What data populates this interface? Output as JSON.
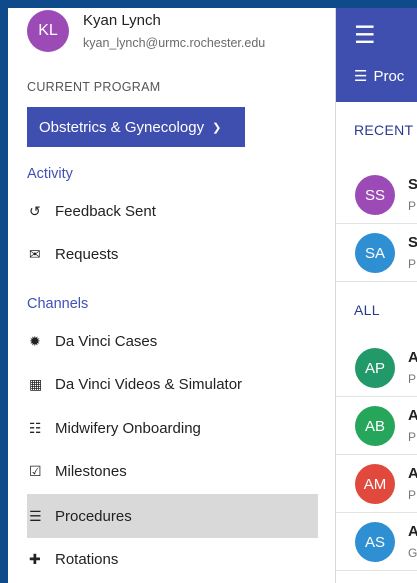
{
  "user": {
    "initials": "KL",
    "name": "Kyan Lynch",
    "email": "kyan_lynch@urmc.rochester.edu",
    "avatar_color": "#9c4bb6"
  },
  "program": {
    "caption": "CURRENT PROGRAM",
    "selected": "Obstetrics & Gynecology"
  },
  "activity": {
    "title": "Activity",
    "items": [
      {
        "label": "Feedback Sent",
        "icon": "history-icon"
      },
      {
        "label": "Requests",
        "icon": "envelope-icon"
      }
    ]
  },
  "channels": {
    "title": "Channels",
    "items": [
      {
        "label": "Da Vinci Cases",
        "icon": "certificate-icon"
      },
      {
        "label": "Da Vinci Videos & Simulator",
        "icon": "film-icon"
      },
      {
        "label": "Midwifery Onboarding",
        "icon": "clipboard-icon"
      },
      {
        "label": "Milestones",
        "icon": "checkbox-icon"
      },
      {
        "label": "Procedures",
        "icon": "list-icon",
        "active": true
      },
      {
        "label": "Rotations",
        "icon": "medkit-icon"
      }
    ]
  },
  "appbar": {
    "title": "Proc",
    "menu_icon": "hamburger-icon",
    "title_icon": "list-icon",
    "color": "#3f4fb0"
  },
  "lists": {
    "recent_label": "RECENT",
    "all_label": "ALL",
    "recent": [
      {
        "initials": "SS",
        "title": "S",
        "sub": "P",
        "color": "#9c4bb6"
      },
      {
        "initials": "SA",
        "title": "S",
        "sub": "P",
        "color": "#2f8fd3"
      }
    ],
    "all": [
      {
        "initials": "AP",
        "title": "A",
        "sub": "P",
        "color": "#229968"
      },
      {
        "initials": "AB",
        "title": "A",
        "sub": "P",
        "color": "#26a65b"
      },
      {
        "initials": "AM",
        "title": "A",
        "sub": "P",
        "color": "#e0493b"
      },
      {
        "initials": "AS",
        "title": "A",
        "sub": "G",
        "color": "#2f8fd3"
      }
    ]
  }
}
